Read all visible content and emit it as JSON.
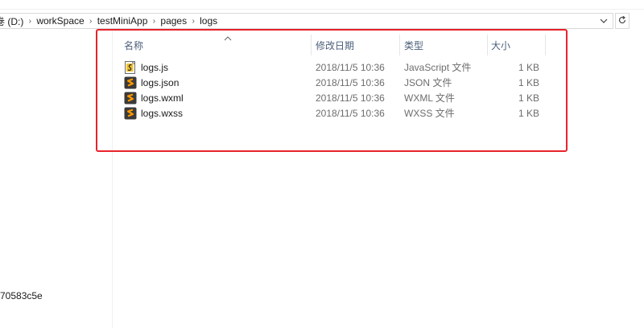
{
  "address": {
    "crumbs": [
      {
        "label": "卷 (D:)"
      },
      {
        "label": "workSpace"
      },
      {
        "label": "testMiniApp"
      },
      {
        "label": "pages"
      },
      {
        "label": "logs"
      }
    ],
    "separator": "›",
    "dropdown_icon": "chevron-down-icon",
    "refresh_icon": "refresh-icon"
  },
  "columns": {
    "name": "名称",
    "date": "修改日期",
    "type": "类型",
    "size": "大小",
    "sorted_by": "name"
  },
  "files": [
    {
      "name": "logs.js",
      "date": "2018/11/5 10:36",
      "type": "JavaScript 文件",
      "size": "1 KB",
      "icon": "js-file-icon"
    },
    {
      "name": "logs.json",
      "date": "2018/11/5 10:36",
      "type": "JSON 文件",
      "size": "1 KB",
      "icon": "sublime-file-icon"
    },
    {
      "name": "logs.wxml",
      "date": "2018/11/5 10:36",
      "type": "WXML 文件",
      "size": "1 KB",
      "icon": "sublime-file-icon"
    },
    {
      "name": "logs.wxss",
      "date": "2018/11/5 10:36",
      "type": "WXSS 文件",
      "size": "1 KB",
      "icon": "sublime-file-icon"
    }
  ],
  "nav": {
    "partial_label": "70583c5e"
  },
  "colors": {
    "highlight": "#e8232a",
    "header_text": "#4c607a",
    "sublime_orange": "#ff9800"
  }
}
